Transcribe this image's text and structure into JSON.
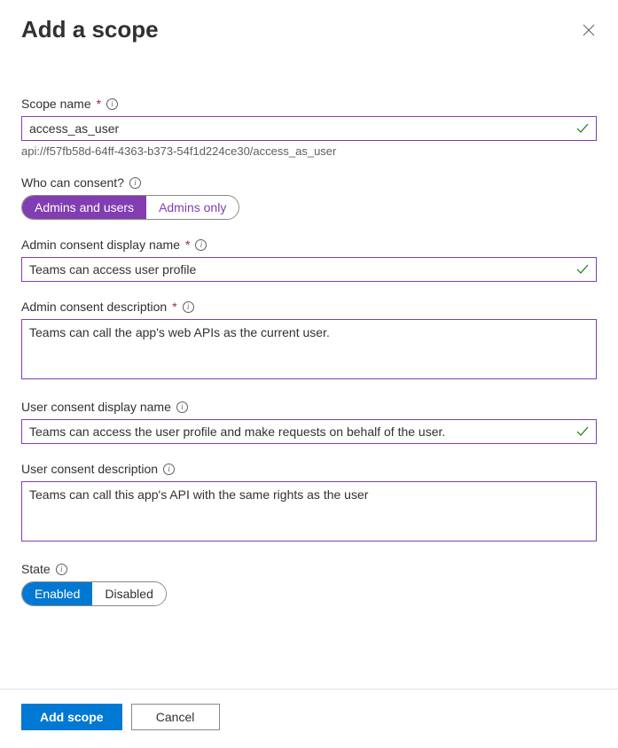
{
  "header": {
    "title": "Add a scope"
  },
  "scope_name": {
    "label": "Scope name",
    "value": "access_as_user",
    "helper": "api://f57fb58d-64ff-4363-b373-54f1d224ce30/access_as_user"
  },
  "consent": {
    "label": "Who can consent?",
    "option_admins_users": "Admins and users",
    "option_admins_only": "Admins only"
  },
  "admin_display": {
    "label": "Admin consent display name",
    "value": "Teams can access user profile"
  },
  "admin_desc": {
    "label": "Admin consent description",
    "value": "Teams can call the app's web APIs as the current user."
  },
  "user_display": {
    "label": "User consent display name",
    "value": "Teams can access the user profile and make requests on behalf of the user."
  },
  "user_desc": {
    "label": "User consent description",
    "value": "Teams can call this app's API with the same rights as the user"
  },
  "state": {
    "label": "State",
    "option_enabled": "Enabled",
    "option_disabled": "Disabled"
  },
  "footer": {
    "add": "Add scope",
    "cancel": "Cancel"
  }
}
